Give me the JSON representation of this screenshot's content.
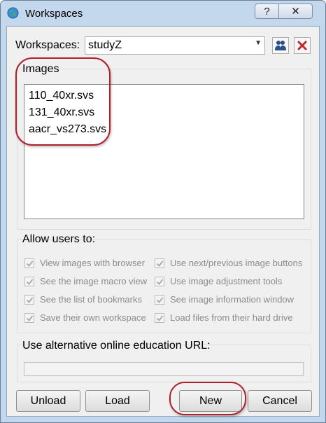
{
  "window": {
    "title": "Workspaces",
    "help_label": "?",
    "close_label": "✕"
  },
  "workspace": {
    "label": "Workspaces:",
    "selected": "studyZ"
  },
  "images": {
    "title": "Images",
    "items": [
      "110_40xr.svs",
      "131_40xr.svs",
      "aacr_vs273.svs"
    ]
  },
  "permissions": {
    "title": "Allow users to:",
    "left": [
      "View images with browser",
      "See the image macro view",
      "See the list of bookmarks",
      "Save their own workspace"
    ],
    "right": [
      "Use next/previous image buttons",
      "Use image adjustment tools",
      "See image information window",
      "Load files from their hard drive"
    ]
  },
  "education": {
    "title": "Use alternative online education URL:",
    "value": ""
  },
  "buttons": {
    "unload": "Unload",
    "load": "Load",
    "new": "New",
    "cancel": "Cancel"
  },
  "colors": {
    "annotation": "#b0202a",
    "title_bar": "#c3d7ed"
  }
}
